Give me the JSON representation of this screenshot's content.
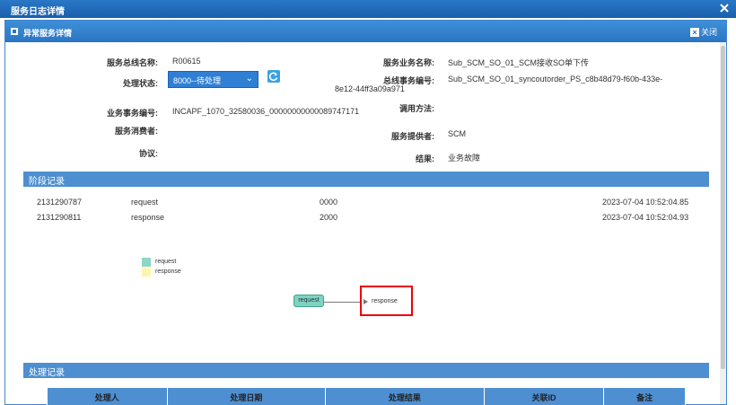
{
  "window": {
    "title": "服务日志详情",
    "close_label": "✕"
  },
  "panel": {
    "title": "异常服务详情",
    "close_label": "关闭"
  },
  "details": {
    "bus_name_label": "服务总线名称:",
    "bus_name_value": "R00615",
    "status_label": "处理状态:",
    "status_value": "8000--待处理",
    "biz_txn_label": "业务事务编号:",
    "biz_txn_value": "INCAPF_1070_32580036_00000000000089747171",
    "consumer_label": "服务消费者:",
    "consumer_value": "",
    "protocol_label": "协议:",
    "protocol_value": "",
    "service_name_label": "服务业务名称:",
    "service_name_value": "Sub_SCM_SO_01_SCM接收SO单下传",
    "bus_txn_label": "总线事务编号:",
    "bus_txn_value_line1": "Sub_SCM_SO_01_syncoutorder_PS_c8b48d79-f60b-433e-",
    "bus_txn_value_line2": "8e12-44ff3a09a971",
    "call_method_label": "调用方法:",
    "call_method_value": "",
    "provider_label": "服务提供者:",
    "provider_value": "SCM",
    "result_label": "结果:",
    "result_value": "业务故障"
  },
  "stage_section": {
    "title": "阶段记录",
    "rows": [
      {
        "id": "2131290787",
        "type": "request",
        "code": "0000",
        "time": "2023-07-04 10:52:04.85"
      },
      {
        "id": "2131290811",
        "type": "response",
        "code": "2000",
        "time": "2023-07-04 10:52:04.93"
      }
    ]
  },
  "flow": {
    "legend": [
      {
        "label": "request",
        "color": "#8ed6c6"
      },
      {
        "label": "response",
        "color": "#fbf6b3"
      }
    ],
    "request_node": "request",
    "response_node": "response"
  },
  "process_section": {
    "title": "处理记录",
    "columns": [
      "处理人",
      "处理日期",
      "处理结果",
      "关联ID",
      "备注"
    ]
  }
}
